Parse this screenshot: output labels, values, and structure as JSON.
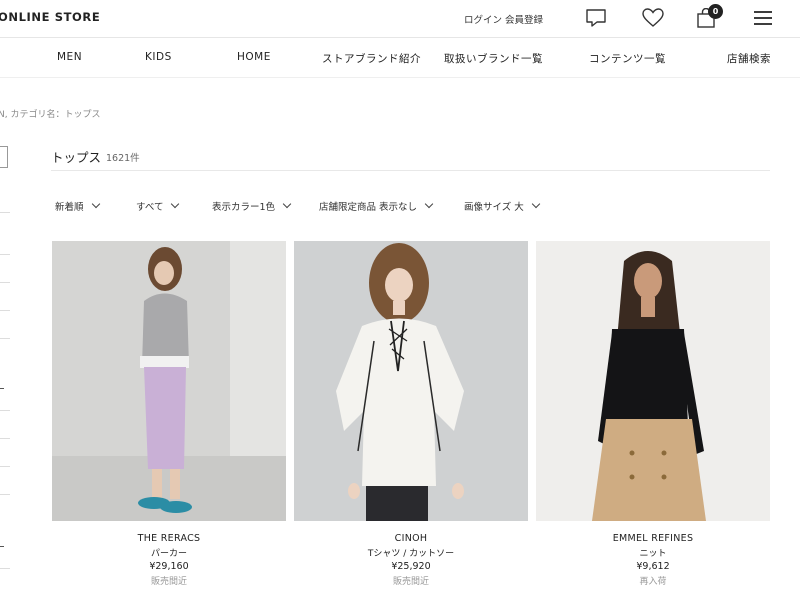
{
  "header": {
    "logo": "ONLINE STORE",
    "login": "ログイン",
    "register": "会員登録",
    "cart_count": "0"
  },
  "nav": {
    "items": [
      "MEN",
      "KIDS",
      "HOME",
      "ストアブランド紹介",
      "取扱いブランド一覧",
      "コンテンツ一覧",
      "店舗検索"
    ]
  },
  "breadcrumb": "N, カテゴリ名：トップス",
  "listing": {
    "title": "トップス",
    "count": "1621件"
  },
  "filters": [
    {
      "label": "新着順"
    },
    {
      "label": "すべて"
    },
    {
      "label": "表示カラー1色"
    },
    {
      "label": "店舗限定商品 表示なし"
    },
    {
      "label": "画像サイズ 大"
    }
  ],
  "products": [
    {
      "brand": "THE RERACS",
      "category": "パーカー",
      "price": "¥29,160",
      "status": "販売間近"
    },
    {
      "brand": "CINOH",
      "category": "Tシャツ / カットソー",
      "price": "¥25,920",
      "status": "販売間近"
    },
    {
      "brand": "EMMEL REFINES",
      "category": "ニット",
      "price": "¥9,612",
      "status": "再入荷"
    }
  ],
  "icons": {
    "chat": "chat-bubble-icon",
    "favorite": "heart-icon",
    "cart": "shopping-bag-icon",
    "menu": "hamburger-menu-icon"
  }
}
